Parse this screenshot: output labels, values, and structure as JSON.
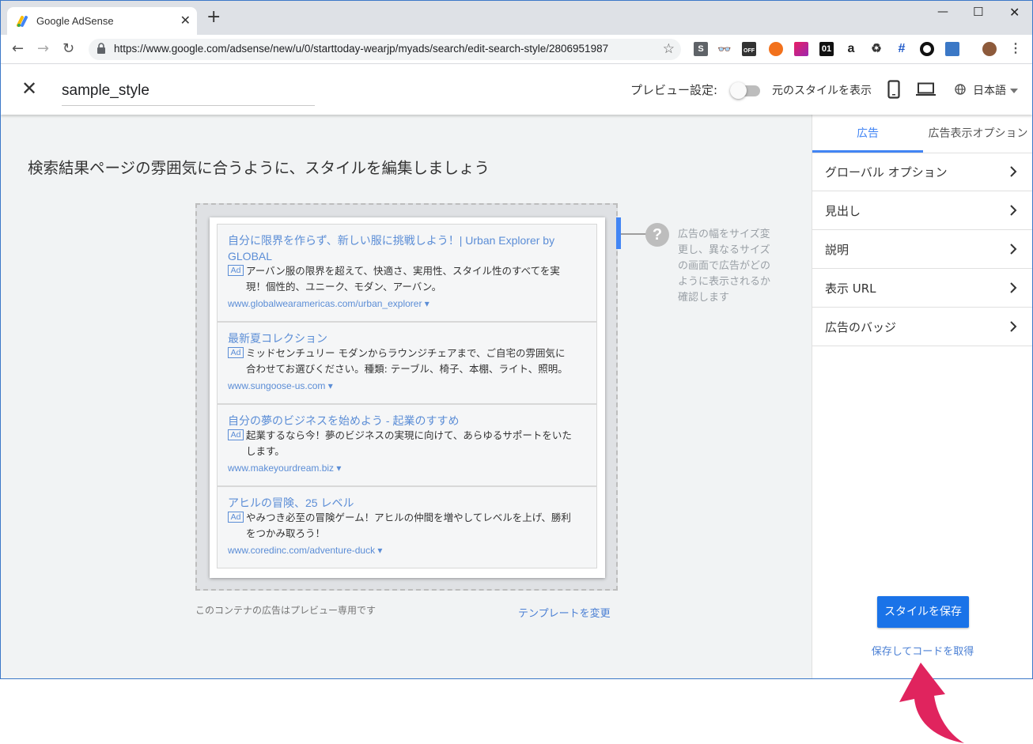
{
  "browser": {
    "tab_title": "Google AdSense",
    "new_tab": "+",
    "url": "https://www.google.com/adsense/new/u/0/starttoday-wearjp/myads/search/edit-search-style/2806951987",
    "extension_labels": [
      "S",
      "OFF",
      "01",
      "a",
      "#"
    ]
  },
  "header": {
    "style_name": "sample_style",
    "preview_label": "プレビュー設定:",
    "original_style_label": "元のスタイルを表示",
    "language": "日本語"
  },
  "main": {
    "headline": "検索結果ページの雰囲気に合うように、スタイルを編集しましょう",
    "ads": [
      {
        "title": "自分に限界を作らず、新しい服に挑戦しよう！| Urban Explorer by GLOBAL",
        "badge": "Ad",
        "description": "アーバン服の限界を超えて、快適さ、実用性、スタイル性のすべてを実現！個性的、ユニーク、モダン、アーバン。",
        "url": "www.globalwearamericas.com/urban_explorer ▾"
      },
      {
        "title": "最新夏コレクション",
        "badge": "Ad",
        "description": "ミッドセンチュリー モダンからラウンジチェアまで、ご自宅の雰囲気に合わせてお選びください。種類: テーブル、椅子、本棚、ライト、照明。",
        "url": "www.sungoose-us.com ▾"
      },
      {
        "title": "自分の夢のビジネスを始めよう - 起業のすすめ",
        "badge": "Ad",
        "description": "起業するなら今！夢のビジネスの実現に向けて、あらゆるサポートをいたします。",
        "url": "www.makeyourdream.biz ▾"
      },
      {
        "title": "アヒルの冒険、25 レベル",
        "badge": "Ad",
        "description": "やみつき必至の冒険ゲーム！アヒルの仲間を増やしてレベルを上げ、勝利をつかみ取ろう！",
        "url": "www.coredinc.com/adventure-duck ▾"
      }
    ],
    "hint_icon": "?",
    "hint": "広告の幅をサイズ変更し、異なるサイズの画面で広告がどのように表示されるか確認します",
    "preview_note": "このコンテナの広告はプレビュー専用です",
    "change_template": "テンプレートを変更"
  },
  "panel": {
    "tabs": [
      "広告",
      "広告表示オプション"
    ],
    "rows": [
      "グローバル オプション",
      "見出し",
      "説明",
      "表示 URL",
      "広告のバッジ"
    ],
    "save_button": "スタイルを保存",
    "save_and_get_code": "保存してコードを取得"
  },
  "colors": {
    "accent": "#4285f4",
    "link": "#5b8dd6",
    "primary_button": "#1a73e8",
    "annotation_arrow": "#e0245e"
  },
  "icons": [
    "adsense-icon",
    "close-icon",
    "back-icon",
    "forward-icon",
    "reload-icon",
    "lock-icon",
    "star-icon",
    "phone-icon",
    "laptop-icon",
    "globe-icon",
    "dropdown-icon",
    "help-icon",
    "chevron-right-icon",
    "arrow-annotation"
  ]
}
